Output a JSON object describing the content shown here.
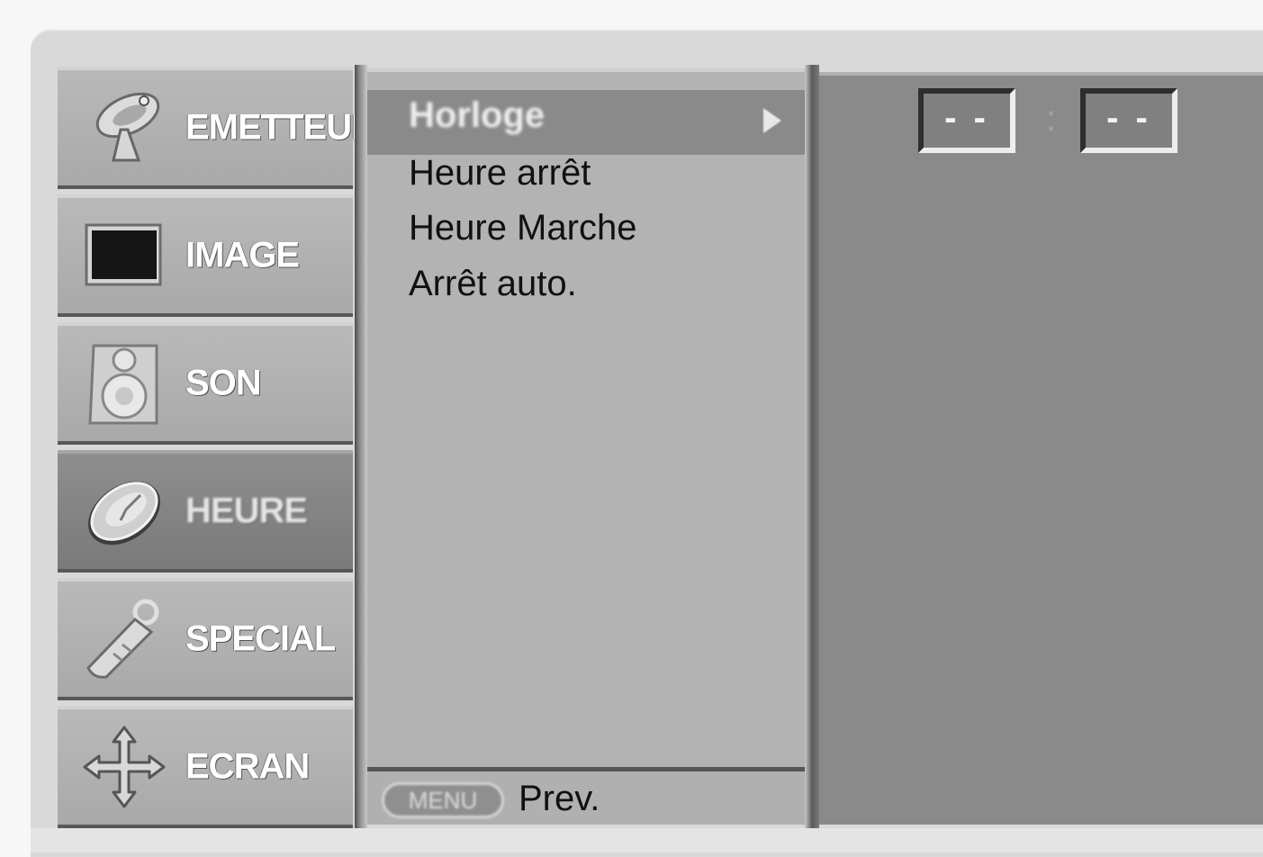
{
  "sidebar": {
    "items": [
      {
        "label": "EMETTEUR",
        "icon": "satellite-dish-icon"
      },
      {
        "label": "IMAGE",
        "icon": "tv-screen-icon"
      },
      {
        "label": "SON",
        "icon": "speaker-icon"
      },
      {
        "label": "HEURE",
        "icon": "clock-icon",
        "active": true
      },
      {
        "label": "SPECIAL",
        "icon": "remote-key-icon"
      },
      {
        "label": "ECRAN",
        "icon": "move-arrows-icon"
      }
    ]
  },
  "submenu": {
    "selected": "Horloge",
    "items": [
      "Heure arrêt",
      "Heure Marche",
      "Arrêt auto."
    ]
  },
  "footer": {
    "menu_button": "MENU",
    "prev_label": "Prev."
  },
  "clock": {
    "hours": "- -",
    "separator": ":",
    "minutes": "- -"
  },
  "colors": {
    "active_tab": "#7f7f7f",
    "panel": "#b3b3b3",
    "value_panel": "#8a8a8a"
  }
}
